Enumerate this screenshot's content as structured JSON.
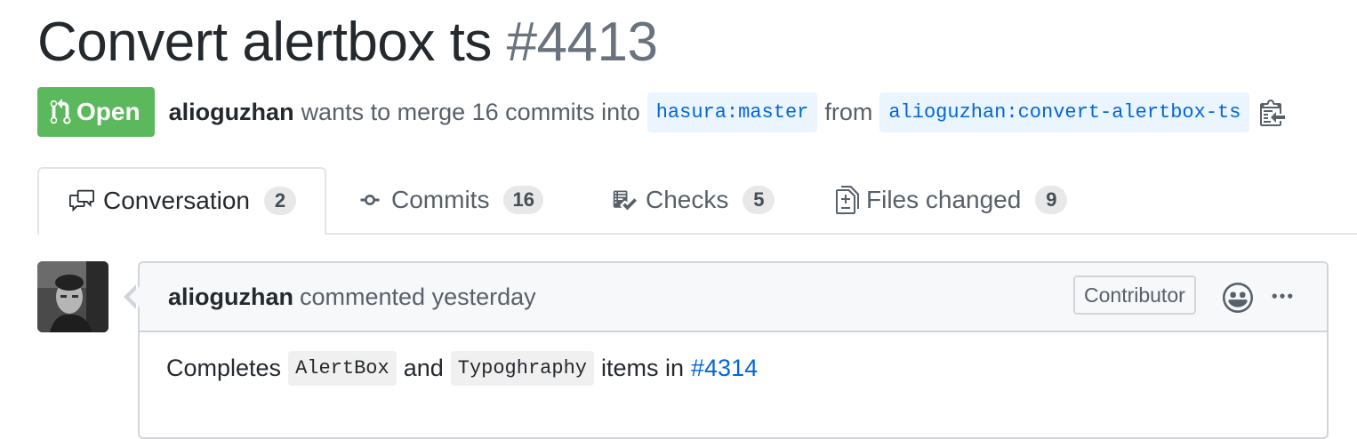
{
  "pr": {
    "title": "Convert alertbox ts",
    "number": "#4413",
    "state": "Open",
    "author": "alioguzhan",
    "merge_text": "wants to merge 16 commits into",
    "base_branch": "hasura:master",
    "from_text": "from",
    "head_branch": "alioguzhan:convert-alertbox-ts"
  },
  "tabs": [
    {
      "label": "Conversation",
      "count": "2",
      "icon": "comment-discussion-icon",
      "selected": true
    },
    {
      "label": "Commits",
      "count": "16",
      "icon": "git-commit-icon"
    },
    {
      "label": "Checks",
      "count": "5",
      "icon": "checklist-icon"
    },
    {
      "label": "Files changed",
      "count": "9",
      "icon": "file-diff-icon"
    }
  ],
  "comment": {
    "author": "alioguzhan",
    "action": "commented yesterday",
    "badge": "Contributor",
    "body": {
      "prefix": "Completes",
      "code1": "AlertBox",
      "and": "and",
      "code2": "Typoghraphy",
      "middle": "items in",
      "link": "#4314"
    }
  },
  "colors": {
    "open_green": "#5cb85c",
    "link_blue": "#0366d6",
    "branch_bg": "#eaf5ff",
    "header_bg": "#f6f8fa",
    "border": "#d1d5da"
  }
}
